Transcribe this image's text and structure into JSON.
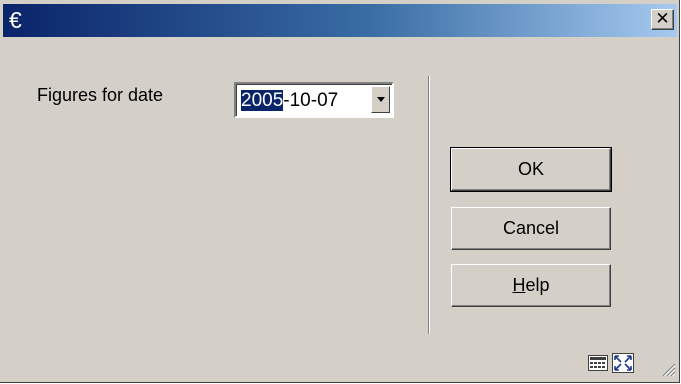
{
  "titlebar": {
    "icon_glyph": "€",
    "close_glyph": "✕"
  },
  "form": {
    "label": "Figures for date",
    "date_value_selected": "2005",
    "date_value_rest": "-10-07"
  },
  "buttons": {
    "ok": "OK",
    "cancel": "Cancel",
    "help_accel": "H",
    "help_rest": "elp"
  },
  "statusbar": {
    "icons": [
      "calculator-icon",
      "resize-window-icon",
      "size-grip-icon"
    ]
  },
  "colors": {
    "titlebar_start": "#0a246a",
    "titlebar_end": "#a6caf0",
    "dialog_bg": "#d4d0c8",
    "selection": "#0a246a"
  }
}
